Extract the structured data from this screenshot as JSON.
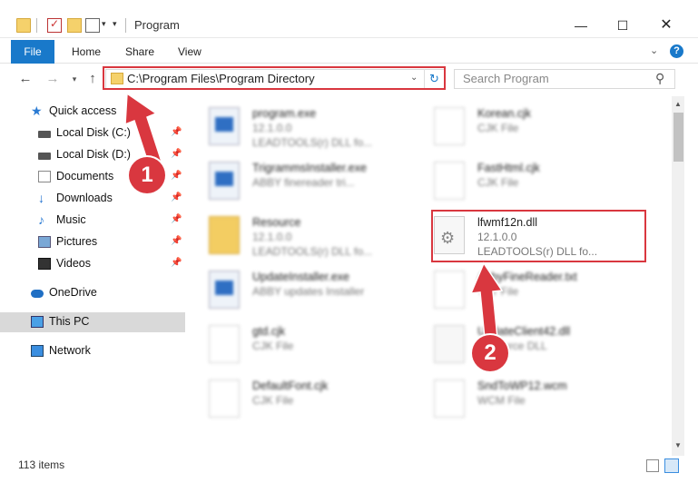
{
  "window": {
    "title": "Program",
    "min_icon": "minimize-icon",
    "max_icon": "maximize-icon",
    "close_icon": "close-icon"
  },
  "ribbon": {
    "tabs": [
      "File",
      "Home",
      "Share",
      "View"
    ]
  },
  "address": {
    "path": "C:\\Program Files\\Program Directory",
    "search_placeholder": "Search Program"
  },
  "nav": {
    "items": [
      {
        "label": "Quick access",
        "icon": "star-icon"
      },
      {
        "label": "Local Disk (C:)",
        "icon": "drive-icon",
        "pinned": true
      },
      {
        "label": "Local Disk (D:)",
        "icon": "drive-icon",
        "pinned": true
      },
      {
        "label": "Documents",
        "icon": "documents-icon",
        "pinned": true
      },
      {
        "label": "Downloads",
        "icon": "downloads-icon",
        "pinned": true
      },
      {
        "label": "Music",
        "icon": "music-icon",
        "pinned": true
      },
      {
        "label": "Pictures",
        "icon": "pictures-icon",
        "pinned": true
      },
      {
        "label": "Videos",
        "icon": "videos-icon",
        "pinned": true
      },
      {
        "label": "OneDrive",
        "icon": "onedrive-icon"
      },
      {
        "label": "This PC",
        "icon": "computer-icon",
        "selected": true
      },
      {
        "label": "Network",
        "icon": "network-icon"
      }
    ]
  },
  "files": {
    "left": [
      {
        "name": "program.exe",
        "line2": "12.1.0.0",
        "line3": "LEADTOOLS(r) DLL fo..."
      },
      {
        "name": "TrigrammsInstaller.exe",
        "line2": "ABBY finereader tri..."
      },
      {
        "name": "Resource",
        "line2": "12.1.0.0",
        "line3": "LEADTOOLS(r) DLL fo..."
      },
      {
        "name": "UpdateInstaller.exe",
        "line2": "ABBY updates Installer"
      },
      {
        "name": "gtd.cjk",
        "line2": "CJK File"
      },
      {
        "name": "DefaultFont.cjk",
        "line2": "CJK File"
      }
    ],
    "right": [
      {
        "name": "Korean.cjk",
        "line2": "CJK File"
      },
      {
        "name": "FastHtml.cjk",
        "line2": "CJK File"
      },
      {
        "name": "lfwmf12n.dll",
        "line2": "12.1.0.0",
        "line3": "LEADTOOLS(r) DLL fo..."
      },
      {
        "name": "AbbyFineReader.txt",
        "line2": "TXT File"
      },
      {
        "name": "UpdateClient42.dll",
        "line2": "Resource DLL"
      },
      {
        "name": "SndToWP12.wcm",
        "line2": "WCM File"
      }
    ]
  },
  "status": {
    "item_count": "113 items"
  },
  "annotations": {
    "step1": "1",
    "step2": "2",
    "color": "#d9373f"
  }
}
